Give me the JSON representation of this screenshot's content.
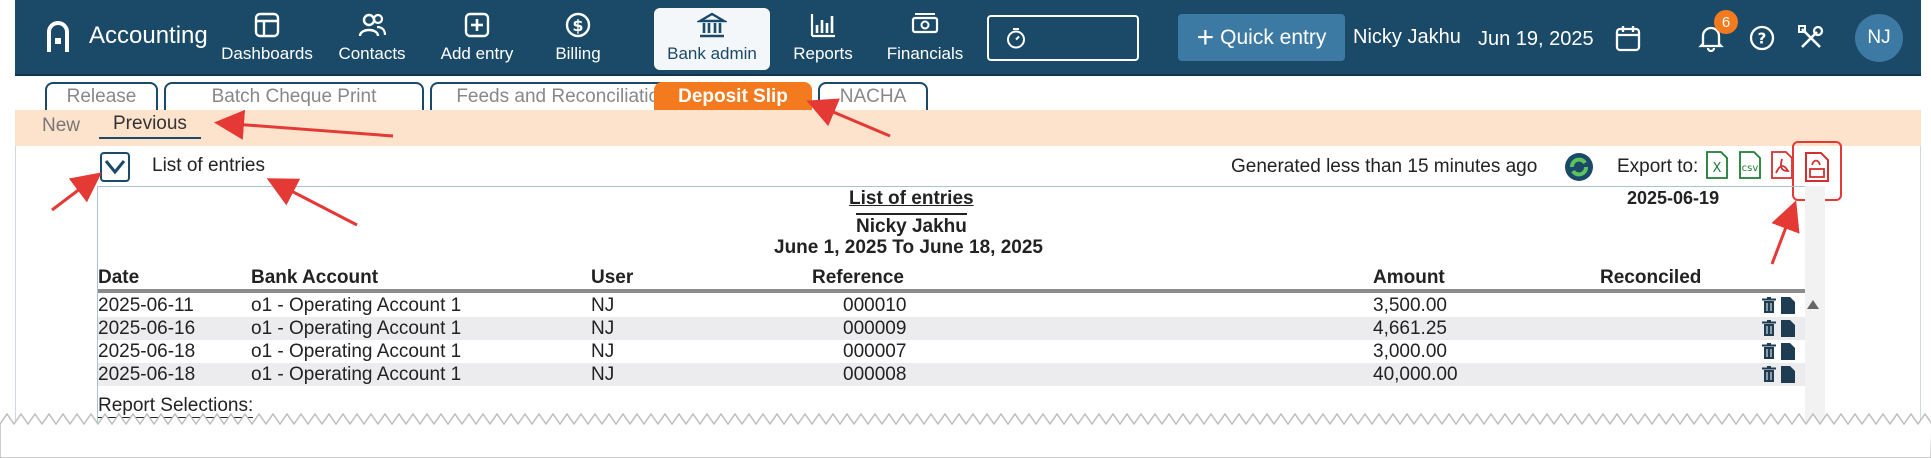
{
  "app": {
    "name": "Accounting"
  },
  "nav": {
    "items": [
      {
        "label": "Dashboards",
        "icon": "dashboard-icon"
      },
      {
        "label": "Contacts",
        "icon": "contacts-icon"
      },
      {
        "label": "Add entry",
        "icon": "add-entry-icon"
      },
      {
        "label": "Billing",
        "icon": "dollar-icon"
      },
      {
        "label": "Bank admin",
        "icon": "bank-icon",
        "active": true
      },
      {
        "label": "Reports",
        "icon": "bar-chart-icon"
      },
      {
        "label": "Financials",
        "icon": "money-icon"
      }
    ],
    "quick_entry": "Quick entry",
    "user_name": "Nicky Jakhu",
    "date": "Jun 19, 2025",
    "notifications": "6",
    "avatar_initials": "NJ"
  },
  "subtabs": [
    {
      "label": "Release"
    },
    {
      "label": "Batch Cheque Print"
    },
    {
      "label": "Feeds and Reconciliation"
    },
    {
      "label": "Deposit Slip",
      "active": true
    },
    {
      "label": "NACHA"
    }
  ],
  "mode_bar": {
    "new": "New",
    "previous": "Previous"
  },
  "report_toolbar": {
    "title": "List of entries",
    "generated": "Generated less than 15 minutes ago",
    "export_label": "Export to:"
  },
  "report": {
    "title": "List of entries",
    "subtitle": "Nicky Jakhu",
    "period": "June 1, 2025 To June 18, 2025",
    "date": "2025-06-19",
    "columns": [
      "Date",
      "Bank Account",
      "User",
      "Reference",
      "Amount",
      "Reconciled"
    ],
    "rows": [
      {
        "date": "2025-06-11",
        "account": "o1 - Operating Account 1",
        "user": "NJ",
        "reference": "000010",
        "amount": "3,500.00",
        "reconciled": ""
      },
      {
        "date": "2025-06-16",
        "account": "o1 - Operating Account 1",
        "user": "NJ",
        "reference": "000009",
        "amount": "4,661.25",
        "reconciled": ""
      },
      {
        "date": "2025-06-18",
        "account": "o1 - Operating Account 1",
        "user": "NJ",
        "reference": "000007",
        "amount": "3,000.00",
        "reconciled": ""
      },
      {
        "date": "2025-06-18",
        "account": "o1 - Operating Account 1",
        "user": "NJ",
        "reference": "000008",
        "amount": "40,000.00",
        "reconciled": ""
      }
    ],
    "selections_label": "Report Selections:"
  },
  "colors": {
    "navbar": "#1a4a68",
    "accent_orange": "#f47a20",
    "mode_bar_bg": "#fde2cc",
    "annotation_red": "#e53935"
  }
}
